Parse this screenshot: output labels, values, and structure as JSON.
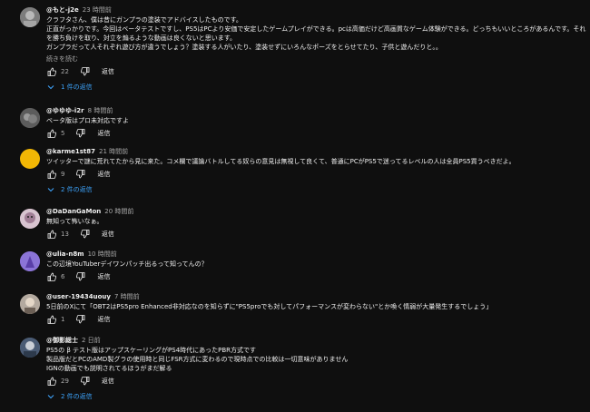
{
  "comments": [
    {
      "author": "@もと-j2e",
      "time": "23 時間前",
      "text": "クラフタさん、僕は昔にガンプラの塗装でアドバイスしたものです。\n正直がっかりです。今回はベータテストですし、PS5はPCより安価で安定したゲームプレイができる。pcは高価だけど高画質なゲーム体験ができる。どっちもいいところがあるんです。それを勝ち負けを取り、対立を煽るような動画は良くないと思います。\nガンプラだって人それぞれ遊び方が違うでしょう？塗装する人がいたり、塗装せずにいろんなポーズをとらせてたり、子供と遊んだりと。。",
      "read_more": "続きを読む",
      "likes": "22",
      "reply_label": "返信",
      "replies_label": "1 件の返信",
      "avatar_color": "#8a8a8a"
    },
    {
      "author": "@ゆゆゆ-i2r",
      "time": "8 時間前",
      "text": "ベータ版はプロ未対応ですよ",
      "likes": "5",
      "reply_label": "返信",
      "avatar_color": "#6e6e6e"
    },
    {
      "author": "@karme1st87",
      "time": "21 時間前",
      "text": "ツイッターで謎に荒れてたから見に来た。コメ欄で議論バトルしてる奴らの意見は無視して良くて、普通にPCがPS5で迷ってるレベルの人は全員PS5買うべきだよ。",
      "likes": "9",
      "reply_label": "返信",
      "replies_label": "2 件の返信",
      "avatar_color": "#f2b705"
    },
    {
      "author": "@DaDanGaMon",
      "time": "20 時間前",
      "text": "無知って怖いなぁ。",
      "likes": "13",
      "reply_label": "返信",
      "avatar_color": "#c7a3b8"
    },
    {
      "author": "@ulia-n8m",
      "time": "10 時間前",
      "text": "この辺境YouTuberデイワンパッチ出るって知ってんの？",
      "likes": "6",
      "reply_label": "返信",
      "avatar_color": "#7a5fc8"
    },
    {
      "author": "@user-19434uouy",
      "time": "7 時間前",
      "text": "5日前のXにて「OBT2はPS5pro Enhanced非対応なのを知らずに\"PS5proでも対してパフォーマンスが変わらない\"とか喚く情弱が大量発生するでしょう」",
      "likes": "1",
      "reply_label": "返信",
      "avatar_color": "#9a8f86"
    },
    {
      "author": "@御影総士",
      "time": "2 日前",
      "text": "PS5の β テスト版はアップスケーリングがPS4時代にあったPBR方式です\n製品版だとPCのAMD製グラの使用時と同じFSR方式に変わるので現時点での比較は一切意味がありません\nIGNの動画でも説明されてるほうがまだ解る",
      "likes": "29",
      "reply_label": "返信",
      "replies_label": "2 件の返信",
      "avatar_color": "#5a6e8a"
    }
  ]
}
